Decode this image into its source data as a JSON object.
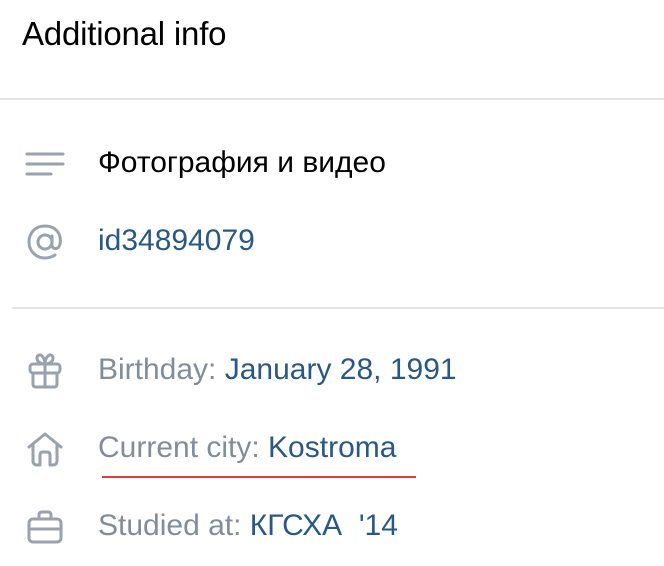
{
  "section": {
    "title": "Additional info"
  },
  "items": {
    "photo_video": {
      "label": "Фотография и видео",
      "icon": "lines-icon"
    },
    "profile_id": {
      "value": "id34894079",
      "icon": "at-icon"
    },
    "birthday": {
      "label": "Birthday: ",
      "value": "January 28, 1991",
      "icon": "gift-icon"
    },
    "city": {
      "label": "Current city: ",
      "value": "Kostroma",
      "icon": "home-icon"
    },
    "studied": {
      "label": "Studied at: ",
      "value": "КГСХА  '14",
      "icon": "briefcase-icon"
    }
  },
  "colors": {
    "link": "#2a5885",
    "muted": "#828d99",
    "icon": "#99a2ad",
    "underline_annotation": "#e63b3b",
    "divider": "#e3e4e8"
  }
}
